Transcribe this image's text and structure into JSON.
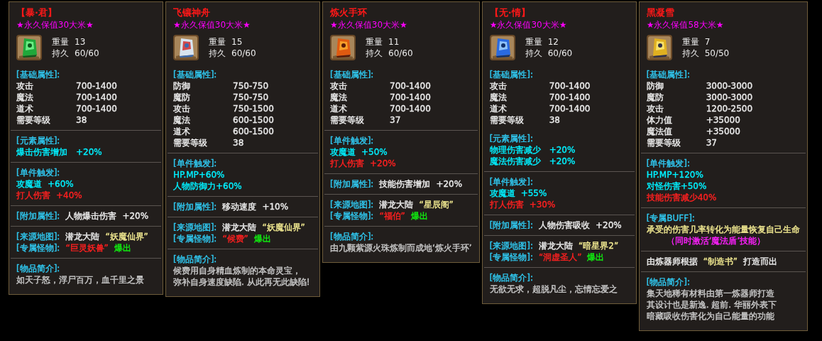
{
  "items": [
    {
      "name": "【暴·君】",
      "value_text": "★永久保值30大米★",
      "weight_label": "重量",
      "weight": "13",
      "durability_label": "持久",
      "durability": "60/60",
      "icon": {
        "kind": "picture"
      },
      "sections": [
        {
          "divider": false,
          "lines": [
            {
              "kind": "text",
              "segments": [
                {
                  "text": "[基础属性]:",
                  "color": "#30c8f0"
                }
              ]
            },
            {
              "kind": "stat",
              "label": "攻击",
              "value": "700-1400",
              "color": "#ececec"
            },
            {
              "kind": "stat",
              "label": "魔法",
              "value": "700-1400",
              "color": "#ececec"
            },
            {
              "kind": "stat",
              "label": "道术",
              "value": "700-1400",
              "color": "#ececec"
            },
            {
              "kind": "stat",
              "label": "需要等级",
              "value": "38",
              "color": "#ececec"
            }
          ]
        },
        {
          "divider": true,
          "lines": [
            {
              "kind": "text",
              "segments": [
                {
                  "text": "[元素属性]:",
                  "color": "#30c8f0"
                }
              ]
            },
            {
              "kind": "stat",
              "label": "爆击伤害增加",
              "value": "+20%",
              "color": "#00f0ff"
            }
          ]
        },
        {
          "divider": true,
          "lines": [
            {
              "kind": "text",
              "segments": [
                {
                  "text": "[单件触发]:",
                  "color": "#30c8f0"
                }
              ]
            },
            {
              "kind": "text",
              "segments": [
                {
                  "text": "攻魔道",
                  "color": "#00f0ff"
                },
                {
                  "text": "+60%",
                  "color": "#00f0ff"
                }
              ]
            },
            {
              "kind": "text",
              "segments": [
                {
                  "text": "打人伤害",
                  "color": "#ff2020"
                },
                {
                  "text": "+40%",
                  "color": "#ff2020"
                }
              ]
            }
          ]
        },
        {
          "divider": true,
          "lines": [
            {
              "kind": "text",
              "segments": [
                {
                  "text": "[附加属性]:",
                  "color": "#30c8f0"
                },
                {
                  "text": "人物爆击伤害",
                  "color": "#ececec"
                },
                {
                  "text": "+20%",
                  "color": "#ececec"
                }
              ]
            }
          ]
        },
        {
          "divider": true,
          "lines": [
            {
              "kind": "text",
              "segments": [
                {
                  "text": "[来源地图]:",
                  "color": "#30c8f0"
                },
                {
                  "text": "潜龙大陆",
                  "color": "#ececec"
                },
                {
                  "text": "“妖魔仙界”",
                  "color": "#f0e890"
                }
              ]
            },
            {
              "kind": "text",
              "segments": [
                {
                  "text": "[专属怪物]:",
                  "color": "#30c8f0"
                },
                {
                  "text": "“巨灵妖兽”",
                  "color": "#ff2020"
                },
                {
                  "text": "爆出",
                  "color": "#10f010"
                }
              ]
            }
          ]
        },
        {
          "divider": true,
          "lines": [
            {
              "kind": "text",
              "segments": [
                {
                  "text": "[物品简介]:",
                  "color": "#30c8f0"
                }
              ]
            },
            {
              "kind": "text",
              "segments": [
                {
                  "text": "如天子怒，浮尸百万，血千里之景",
                  "color": "#c8c8c8"
                }
              ]
            }
          ]
        }
      ]
    },
    {
      "name": "飞镶神舟",
      "value_text": "★永久保值30大米★",
      "weight_label": "重量",
      "weight": "15",
      "durability_label": "持久",
      "durability": "60/60",
      "icon": {
        "kind": "picture"
      },
      "sections": [
        {
          "divider": false,
          "lines": [
            {
              "kind": "text",
              "segments": [
                {
                  "text": "[基础属性]:",
                  "color": "#30c8f0"
                }
              ]
            },
            {
              "kind": "stat",
              "label": "防御",
              "value": "750-750",
              "color": "#ececec"
            },
            {
              "kind": "stat",
              "label": "魔防",
              "value": "750-750",
              "color": "#ececec"
            },
            {
              "kind": "stat",
              "label": "攻击",
              "value": "750-1500",
              "color": "#ececec"
            },
            {
              "kind": "stat",
              "label": "魔法",
              "value": "600-1500",
              "color": "#ececec"
            },
            {
              "kind": "stat",
              "label": "道术",
              "value": "600-1500",
              "color": "#ececec"
            },
            {
              "kind": "stat",
              "label": "需要等级",
              "value": "38",
              "color": "#ececec"
            }
          ]
        },
        {
          "divider": true,
          "lines": [
            {
              "kind": "text",
              "segments": [
                {
                  "text": "[单件触发]:",
                  "color": "#30c8f0"
                }
              ]
            },
            {
              "kind": "text",
              "segments": [
                {
                  "text": "HP.MP+60%",
                  "color": "#00f0ff"
                }
              ]
            },
            {
              "kind": "text",
              "segments": [
                {
                  "text": "人物防御力+60%",
                  "color": "#00f0ff"
                }
              ]
            }
          ]
        },
        {
          "divider": true,
          "lines": [
            {
              "kind": "text",
              "segments": [
                {
                  "text": "[附加属性]:",
                  "color": "#30c8f0"
                },
                {
                  "text": "移动速度",
                  "color": "#ececec"
                },
                {
                  "text": "+10%",
                  "color": "#ececec"
                }
              ]
            }
          ]
        },
        {
          "divider": true,
          "lines": [
            {
              "kind": "text",
              "segments": [
                {
                  "text": "[来源地图]:",
                  "color": "#30c8f0"
                },
                {
                  "text": "潜龙大陆",
                  "color": "#ececec"
                },
                {
                  "text": "“妖魔仙界”",
                  "color": "#f0e890"
                }
              ]
            },
            {
              "kind": "text",
              "segments": [
                {
                  "text": "[专属怪物]:",
                  "color": "#30c8f0"
                },
                {
                  "text": "“候费”",
                  "color": "#ff2020"
                },
                {
                  "text": "爆出",
                  "color": "#10f010"
                }
              ]
            }
          ]
        },
        {
          "divider": true,
          "lines": [
            {
              "kind": "text",
              "segments": [
                {
                  "text": "[物品简介]:",
                  "color": "#30c8f0"
                }
              ]
            },
            {
              "kind": "text",
              "segments": [
                {
                  "text": "候费用自身精血炼制的本命灵宝，",
                  "color": "#c8c8c8"
                }
              ]
            },
            {
              "kind": "text",
              "segments": [
                {
                  "text": "弥补自身速度缺陷. 从此再无此缺陷!",
                  "color": "#c8c8c8"
                }
              ]
            }
          ]
        }
      ]
    },
    {
      "name": "炼火手环",
      "value_text": "★永久保值30大米★",
      "weight_label": "重量",
      "weight": "11",
      "durability_label": "持久",
      "durability": "60/60",
      "icon": {
        "kind": "picture"
      },
      "sections": [
        {
          "divider": false,
          "lines": [
            {
              "kind": "text",
              "segments": [
                {
                  "text": "[基础属性]:",
                  "color": "#30c8f0"
                }
              ]
            },
            {
              "kind": "stat",
              "label": "攻击",
              "value": "700-1400",
              "color": "#ececec"
            },
            {
              "kind": "stat",
              "label": "魔法",
              "value": "700-1400",
              "color": "#ececec"
            },
            {
              "kind": "stat",
              "label": "道术",
              "value": "700-1400",
              "color": "#ececec"
            },
            {
              "kind": "stat",
              "label": "需要等级",
              "value": "37",
              "color": "#ececec"
            }
          ]
        },
        {
          "divider": true,
          "lines": [
            {
              "kind": "text",
              "segments": [
                {
                  "text": "[单件触发]:",
                  "color": "#30c8f0"
                }
              ]
            },
            {
              "kind": "text",
              "segments": [
                {
                  "text": "攻魔道",
                  "color": "#00f0ff"
                },
                {
                  "text": "+50%",
                  "color": "#00f0ff"
                }
              ]
            },
            {
              "kind": "text",
              "segments": [
                {
                  "text": "打人伤害",
                  "color": "#ff2020"
                },
                {
                  "text": "+20%",
                  "color": "#ff2020"
                }
              ]
            }
          ]
        },
        {
          "divider": true,
          "lines": [
            {
              "kind": "text",
              "segments": [
                {
                  "text": "[附加属性]:",
                  "color": "#30c8f0"
                },
                {
                  "text": "技能伤害增加",
                  "color": "#ececec"
                },
                {
                  "text": "+20%",
                  "color": "#ececec"
                }
              ]
            }
          ]
        },
        {
          "divider": true,
          "lines": [
            {
              "kind": "text",
              "segments": [
                {
                  "text": "[来源地图]:",
                  "color": "#30c8f0"
                },
                {
                  "text": "潜龙大陆",
                  "color": "#ececec"
                },
                {
                  "text": "“星辰阁”",
                  "color": "#f0e890"
                }
              ]
            },
            {
              "kind": "text",
              "segments": [
                {
                  "text": "[专属怪物]:",
                  "color": "#30c8f0"
                },
                {
                  "text": "“福伯”",
                  "color": "#ff2020"
                },
                {
                  "text": "爆出",
                  "color": "#10f010"
                }
              ]
            }
          ]
        },
        {
          "divider": true,
          "lines": [
            {
              "kind": "text",
              "segments": [
                {
                  "text": "[物品简介]:",
                  "color": "#30c8f0"
                }
              ]
            },
            {
              "kind": "text",
              "segments": [
                {
                  "text": "由九颗紫源火珠炼制而成地‘炼火手环’",
                  "color": "#c8c8c8"
                }
              ]
            }
          ]
        }
      ]
    },
    {
      "name": "【无·情】",
      "value_text": "★永久保值30大米★",
      "weight_label": "重量",
      "weight": "12",
      "durability_label": "持久",
      "durability": "60/60",
      "icon": {
        "kind": "picture"
      },
      "sections": [
        {
          "divider": false,
          "lines": [
            {
              "kind": "text",
              "segments": [
                {
                  "text": "[基础属性]:",
                  "color": "#30c8f0"
                }
              ]
            },
            {
              "kind": "stat",
              "label": "攻击",
              "value": "700-1400",
              "color": "#ececec"
            },
            {
              "kind": "stat",
              "label": "魔法",
              "value": "700-1400",
              "color": "#ececec"
            },
            {
              "kind": "stat",
              "label": "道术",
              "value": "700-1400",
              "color": "#ececec"
            },
            {
              "kind": "stat",
              "label": "需要等级",
              "value": "38",
              "color": "#ececec"
            }
          ]
        },
        {
          "divider": false,
          "lines": [
            {
              "kind": "text",
              "segments": [
                {
                  "text": "[元素属性]:",
                  "color": "#30c8f0"
                }
              ]
            },
            {
              "kind": "stat",
              "label": "物理伤害减少",
              "value": "+20%",
              "color": "#00f0ff"
            },
            {
              "kind": "stat",
              "label": "魔法伤害减少",
              "value": "+20%",
              "color": "#00f0ff"
            }
          ]
        },
        {
          "divider": true,
          "lines": [
            {
              "kind": "text",
              "segments": [
                {
                  "text": "[单件触发]:",
                  "color": "#30c8f0"
                }
              ]
            },
            {
              "kind": "text",
              "segments": [
                {
                  "text": "攻魔道",
                  "color": "#00f0ff"
                },
                {
                  "text": "+55%",
                  "color": "#00f0ff"
                }
              ]
            },
            {
              "kind": "text",
              "segments": [
                {
                  "text": "打人伤害",
                  "color": "#ff2020"
                },
                {
                  "text": "+30%",
                  "color": "#ff2020"
                }
              ]
            }
          ]
        },
        {
          "divider": true,
          "lines": [
            {
              "kind": "text",
              "segments": [
                {
                  "text": "[附加属性]:",
                  "color": "#30c8f0"
                },
                {
                  "text": "人物伤害吸收",
                  "color": "#ececec"
                },
                {
                  "text": "+20%",
                  "color": "#ececec"
                }
              ]
            }
          ]
        },
        {
          "divider": true,
          "lines": [
            {
              "kind": "text",
              "segments": [
                {
                  "text": "[来源地图]:",
                  "color": "#30c8f0"
                },
                {
                  "text": "潜龙大陆",
                  "color": "#ececec"
                },
                {
                  "text": "“暗星界2”",
                  "color": "#f0e890"
                }
              ]
            },
            {
              "kind": "text",
              "segments": [
                {
                  "text": "[专属怪物]:",
                  "color": "#30c8f0"
                },
                {
                  "text": "“洞虚圣人”",
                  "color": "#ff2020"
                },
                {
                  "text": "爆出",
                  "color": "#10f010"
                }
              ]
            }
          ]
        },
        {
          "divider": true,
          "lines": [
            {
              "kind": "text",
              "segments": [
                {
                  "text": "[物品简介]:",
                  "color": "#30c8f0"
                }
              ]
            },
            {
              "kind": "text",
              "segments": [
                {
                  "text": "无欲无求，超脱凡尘，忘情忘爱之",
                  "color": "#c8c8c8"
                }
              ]
            }
          ]
        }
      ]
    },
    {
      "name": "黑凝雪",
      "value_text": "★永久保值58大米★",
      "weight_label": "重量",
      "weight": "7",
      "durability_label": "持久",
      "durability": "50/50",
      "icon": {
        "kind": "picture"
      },
      "sections": [
        {
          "divider": false,
          "lines": [
            {
              "kind": "text",
              "segments": [
                {
                  "text": "[基础属性]:",
                  "color": "#30c8f0"
                }
              ]
            },
            {
              "kind": "stat",
              "label": "防御",
              "value": "3000-3000",
              "color": "#ececec"
            },
            {
              "kind": "stat",
              "label": "魔防",
              "value": "3000-3000",
              "color": "#ececec"
            },
            {
              "kind": "stat",
              "label": "攻击",
              "value": "1200-2500",
              "color": "#ececec"
            },
            {
              "kind": "stat",
              "label": "体力值",
              "value": "+35000",
              "color": "#ececec"
            },
            {
              "kind": "stat",
              "label": "魔法值",
              "value": "+35000",
              "color": "#ececec"
            },
            {
              "kind": "stat",
              "label": "需要等级",
              "value": "37",
              "color": "#ececec"
            }
          ]
        },
        {
          "divider": true,
          "lines": [
            {
              "kind": "text",
              "segments": [
                {
                  "text": "[单件触发]:",
                  "color": "#30c8f0"
                }
              ]
            },
            {
              "kind": "text",
              "segments": [
                {
                  "text": "HP.MP+120%",
                  "color": "#00f0ff"
                }
              ]
            },
            {
              "kind": "text",
              "segments": [
                {
                  "text": "对怪伤害+50%",
                  "color": "#00f0ff"
                }
              ]
            },
            {
              "kind": "text",
              "segments": [
                {
                  "text": "技能伤害减少40%",
                  "color": "#ff2020"
                }
              ]
            }
          ]
        },
        {
          "divider": true,
          "lines": [
            {
              "kind": "text",
              "segments": [
                {
                  "text": "[专属BUFF]:",
                  "color": "#30c8f0"
                }
              ]
            },
            {
              "kind": "text",
              "segments": [
                {
                  "text": "承受的伤害几率转化为能量恢复自己生命",
                  "color": "#f0e890"
                }
              ]
            },
            {
              "kind": "note",
              "segments": [
                {
                  "text": "（同时激活‘魔法盾’技能）",
                  "color": "#ff20ff"
                }
              ]
            }
          ]
        },
        {
          "divider": true,
          "lines": [
            {
              "kind": "text",
              "segments": [
                {
                  "text": "由炼器师根据",
                  "color": "#ececec"
                },
                {
                  "text": "“制造书”",
                  "color": "#f0e890"
                },
                {
                  "text": "打造而出",
                  "color": "#ececec"
                }
              ]
            }
          ]
        },
        {
          "divider": true,
          "lines": [
            {
              "kind": "text",
              "segments": [
                {
                  "text": "[物品简介]:",
                  "color": "#30c8f0"
                }
              ]
            },
            {
              "kind": "text",
              "segments": [
                {
                  "text": "集天地稀有材料由第一炼器师打造",
                  "color": "#c8c8c8"
                }
              ]
            },
            {
              "kind": "text",
              "segments": [
                {
                  "text": "其设计也是新逸. 超前. 华丽外表下",
                  "color": "#c8c8c8"
                }
              ]
            },
            {
              "kind": "text",
              "segments": [
                {
                  "text": "暗藏吸收伤害化为自己能量的功能",
                  "color": "#c8c8c8"
                }
              ]
            }
          ]
        }
      ]
    }
  ]
}
